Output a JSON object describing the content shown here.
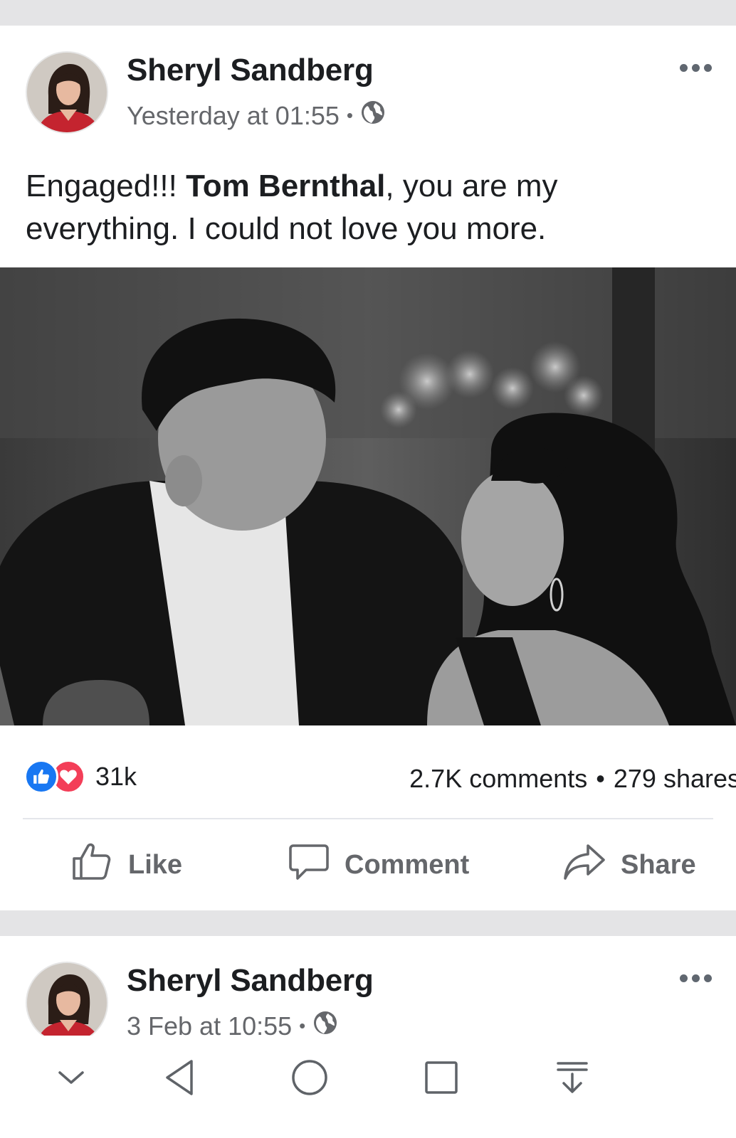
{
  "posts": [
    {
      "author": "Sheryl Sandberg",
      "timestamp": "Yesterday at 01:55",
      "separator": "•",
      "privacy_icon": "globe-icon",
      "text_prefix": "Engaged!!! ",
      "text_tag": "Tom Bernthal",
      "text_suffix": ", you are my everything. I could not love you more.",
      "reactions": {
        "icons": [
          "like-reaction-icon",
          "love-reaction-icon"
        ],
        "count": "31k"
      },
      "comments": "2.7K comments",
      "shares": "279 shares",
      "stats_separator": "•"
    },
    {
      "author": "Sheryl Sandberg",
      "timestamp": "3 Feb at 10:55",
      "separator": "•",
      "privacy_icon": "globe-icon"
    }
  ],
  "actions": {
    "like": "Like",
    "comment": "Comment",
    "share": "Share"
  },
  "nav": [
    "chevron-down-icon",
    "back-triangle-icon",
    "home-circle-icon",
    "recents-square-icon",
    "download-arrow-icon"
  ],
  "colors": {
    "like_blue": "#1877f2",
    "love_red": "#f33e58",
    "meta_gray": "#65676b",
    "band_gray": "#e4e4e6"
  }
}
